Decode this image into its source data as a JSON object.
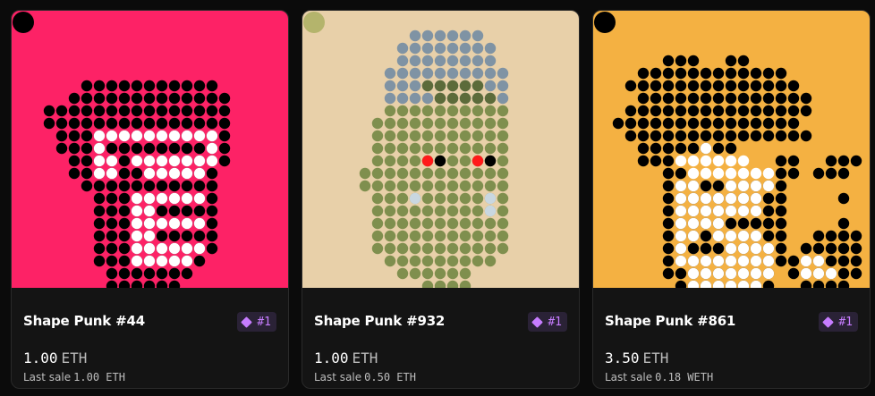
{
  "cards": [
    {
      "title": "Shape Punk #44",
      "rank": "#1",
      "price": "1.00",
      "price_unit": "ETH",
      "last_sale_label": "Last sale",
      "last_sale_value": "1.00 ETH",
      "background": "#fd2266",
      "badge_color": "#000000"
    },
    {
      "title": "Shape Punk #932",
      "rank": "#1",
      "price": "1.00",
      "price_unit": "ETH",
      "last_sale_label": "Last sale",
      "last_sale_value": "0.50 ETH",
      "background": "#e8d0a9",
      "badge_color": "#b4b46c"
    },
    {
      "title": "Shape Punk #861",
      "rank": "#1",
      "price": "3.50",
      "price_unit": "ETH",
      "last_sale_label": "Last sale",
      "last_sale_value": "0.18 WETH",
      "background": "#f4b142",
      "badge_color": "#000000"
    }
  ],
  "colors": {
    "page_bg": "#0b0b0b",
    "card_bg": "#141414",
    "rank_accent": "#c77dff",
    "rank_bg": "#2a2236"
  },
  "icons": {
    "rank": "diamond-icon"
  }
}
